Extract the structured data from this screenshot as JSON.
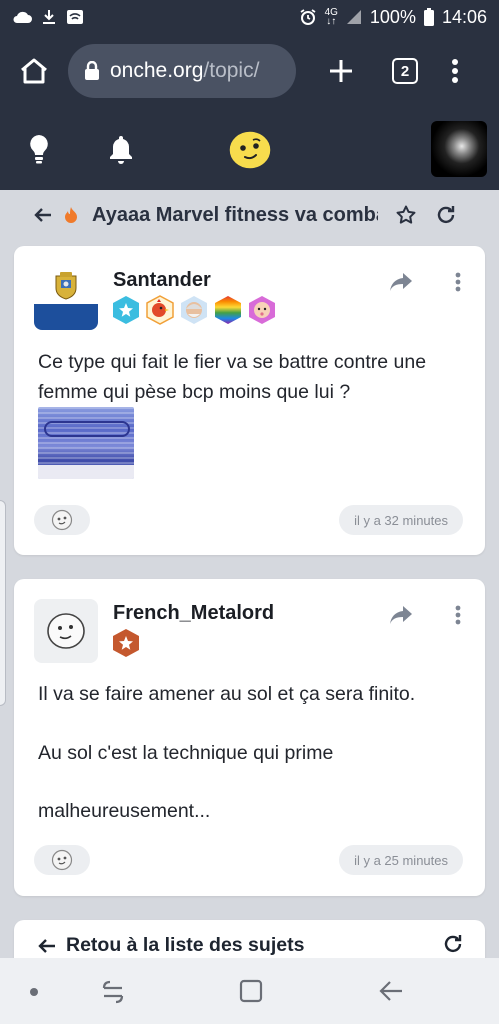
{
  "status_bar": {
    "net_top": "4G",
    "net_bottom": "↓↑",
    "battery": "100%",
    "time": "14:06"
  },
  "browser": {
    "url_domain": "onche.org",
    "url_path": "/topic/",
    "tab_count": "2"
  },
  "topic": {
    "title": "Ayaaa Marvel fitness va combattre"
  },
  "posts": [
    {
      "username": "Santander",
      "badges": [
        "star-badge",
        "rooster-badge",
        "old-man-badge",
        "rainbow-badge",
        "baby-badge"
      ],
      "lines": [
        "Ce type qui fait le fier va se battre contre une femme qui pèse bcp moins que lui ?"
      ],
      "timestamp": "il y a 32 minutes"
    },
    {
      "username": "French_Metalord",
      "badges": [
        "bronze-star-badge"
      ],
      "lines": [
        "Il va se faire amener au sol et ça sera finito.",
        "Au sol c'est la technique qui prime",
        "malheureusement..."
      ],
      "timestamp": "il y a 25 minutes"
    }
  ],
  "footer_card": {
    "back_label": "Retou à la liste des sujets"
  },
  "colors": {
    "header_bg": "#2a3140",
    "page_bg": "#d5d8de",
    "accent_fire": "#f07a2a"
  }
}
